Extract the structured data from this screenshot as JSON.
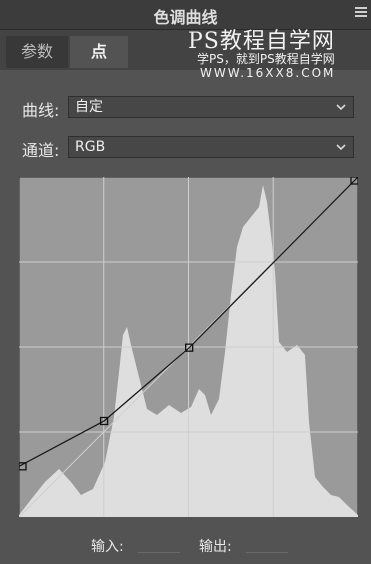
{
  "panel": {
    "title": "色调曲线"
  },
  "tabs": [
    {
      "label": "参数"
    },
    {
      "label": "点"
    }
  ],
  "watermark": {
    "line1": "PS教程自学网",
    "line2": "学PS，就到PS教程自学网",
    "line3": "WWW.16XX8.COM"
  },
  "curve_preset": {
    "label": "曲线:",
    "value": "自定"
  },
  "channel": {
    "label": "通道:",
    "value": "RGB"
  },
  "curve_points": [
    {
      "input": 0,
      "output": 38
    },
    {
      "input": 64,
      "output": 72
    },
    {
      "input": 128,
      "output": 127
    },
    {
      "input": 255,
      "output": 255
    }
  ],
  "input_output": {
    "input_label": "输入:",
    "output_label": "输出:",
    "input_value": "",
    "output_value": ""
  },
  "colors": {
    "panel_bg": "#535353",
    "graph_bg": "#9a9a9a",
    "histogram": "#dedede",
    "curve": "#1a1a1a",
    "grid": "#c8c8c8"
  },
  "icons": {
    "menu": "panel-menu-icon",
    "dropdown": "chevron-down-icon"
  }
}
